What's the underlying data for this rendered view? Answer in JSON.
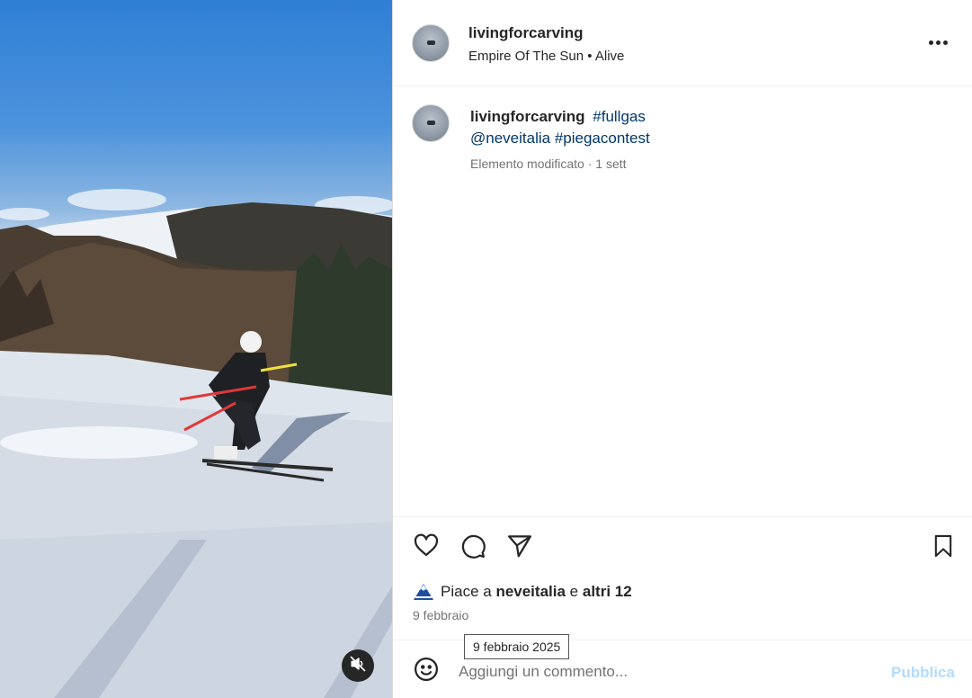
{
  "post": {
    "username": "livingforcarving",
    "audio": "Empire Of The Sun • Alive",
    "more_icon": "more-horizontal-icon"
  },
  "caption": {
    "username": "livingforcarving",
    "tags": [
      "#fullgas",
      "@neveitalia",
      "#piegacontest"
    ],
    "meta": "Elemento modificato · 1 sett"
  },
  "actions": {
    "like_icon": "heart-icon",
    "comment_icon": "comment-icon",
    "share_icon": "paper-plane-icon",
    "save_icon": "bookmark-icon"
  },
  "likes": {
    "prefix": "Piace a",
    "user": "neveitalia",
    "conj": "e",
    "others": "altri 12"
  },
  "date": "9 febbraio",
  "tooltip": "9 febbraio 2025",
  "comment": {
    "placeholder": "Aggiungi un commento...",
    "publish_label": "Pubblica"
  },
  "media": {
    "mute_icon": "speaker-muted-icon"
  },
  "colors": {
    "link": "#00376b",
    "secondary_text": "#737373",
    "publish_disabled": "#b3dbff"
  }
}
